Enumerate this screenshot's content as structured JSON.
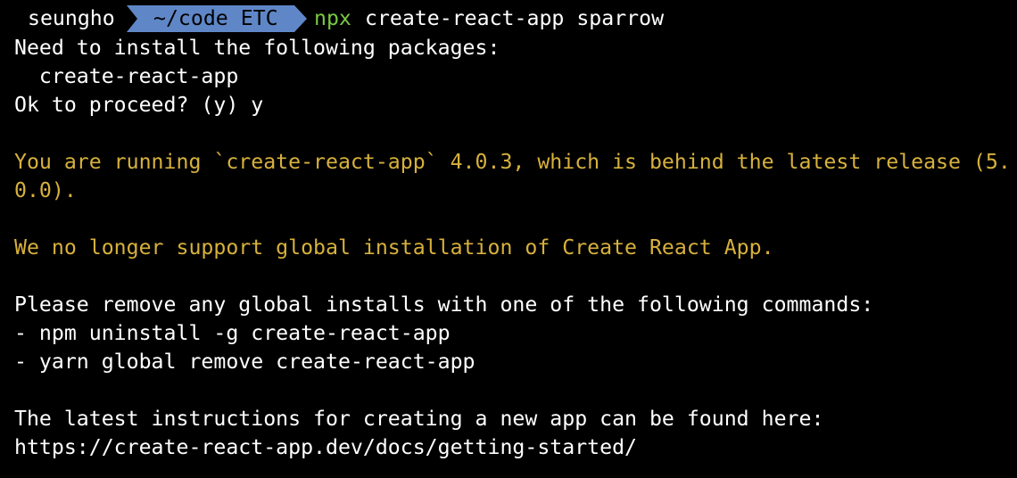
{
  "colors": {
    "background": "#000000",
    "foreground": "#ffffff",
    "warning": "#d7b13c",
    "command": "#7ac943",
    "prompt_segment": "#5f87c7"
  },
  "prompt": {
    "user": "seungho",
    "path": "~/code ETC",
    "command_name": "npx",
    "command_args": "create-react-app sparrow"
  },
  "output": {
    "install_header": "Need to install the following packages:",
    "install_package": "  create-react-app",
    "proceed": "Ok to proceed? (y) y",
    "version_warning_1": "You are running `create-react-app` 4.0.3, which is behind the latest release (5.",
    "version_warning_2": "0.0).",
    "global_warning": "We no longer support global installation of Create React App.",
    "remove_header": "Please remove any global installs with one of the following commands:",
    "remove_npm": "- npm uninstall -g create-react-app",
    "remove_yarn": "- yarn global remove create-react-app",
    "instructions_header": "The latest instructions for creating a new app can be found here:",
    "instructions_url": "https://create-react-app.dev/docs/getting-started/"
  }
}
